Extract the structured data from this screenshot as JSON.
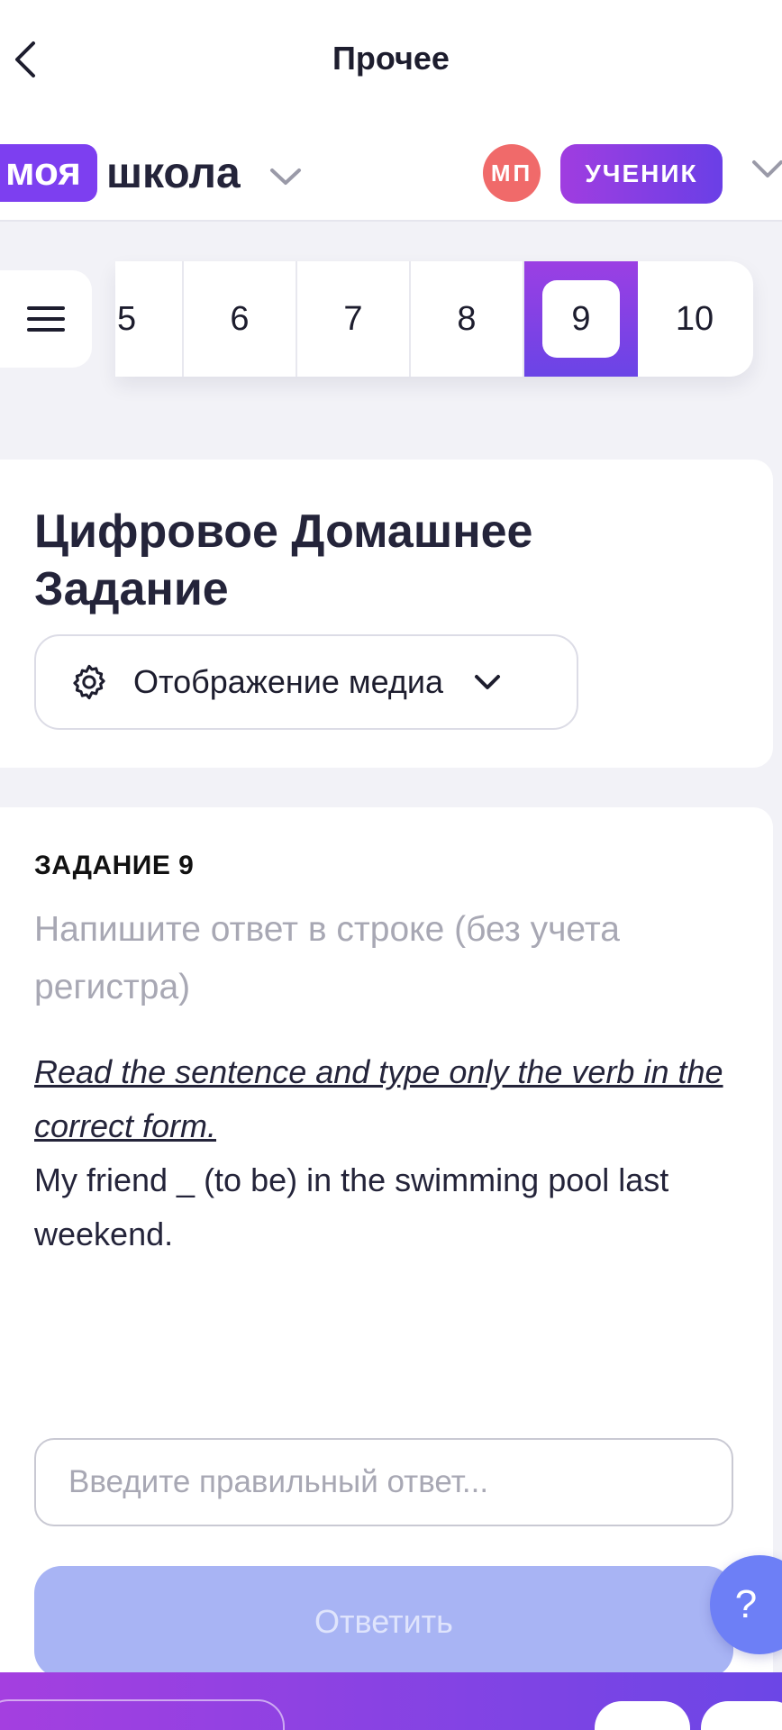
{
  "header": {
    "title": "Прочее",
    "brand_part1": "моя",
    "brand_part2": "школа",
    "avatar_initials": "МП",
    "role": "УЧЕНИК"
  },
  "task_nav": {
    "items": [
      "5",
      "6",
      "7",
      "8",
      "9",
      "10"
    ],
    "active": "9"
  },
  "homework": {
    "title": "Цифровое Домашнее Задание",
    "media_select_label": "Отображение медиа"
  },
  "task": {
    "heading": "ЗАДАНИЕ 9",
    "hint": "Напишите ответ в строке (без учета регистра)",
    "instruction": "Read the sentence and type only the verb in the correct form.",
    "text": "My friend _ (to be) in the swimming pool last weekend.",
    "input_placeholder": "Введите правильный ответ...",
    "input_value": "",
    "submit_label": "Ответить"
  },
  "help": {
    "label": "?"
  },
  "colors": {
    "brand_purple": "#7d3ff0",
    "gradient_start": "#a03de0",
    "gradient_end": "#6a3fe6",
    "avatar": "#f06a6a",
    "submit_disabled": "#a8b4f4"
  },
  "icons": {
    "back": "chevron-left-icon",
    "brand_dropdown": "chevron-down-icon",
    "role_dropdown": "chevron-down-icon",
    "menu": "hamburger-icon",
    "media_settings": "gear-icon",
    "media_dropdown": "chevron-down-icon"
  }
}
